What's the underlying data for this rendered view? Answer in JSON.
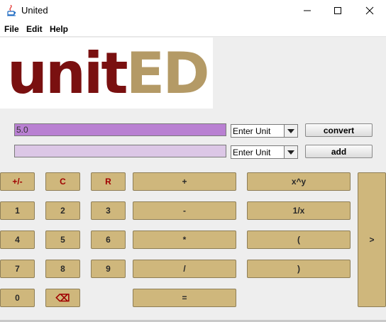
{
  "window": {
    "title": "United"
  },
  "menu": {
    "file": "File",
    "edit": "Edit",
    "help": "Help"
  },
  "logo": {
    "part1": "unit",
    "part2": "ED"
  },
  "converter": {
    "input_value": "5.0",
    "output_value": "",
    "unit1": "Enter Unit",
    "unit2": "Enter Unit",
    "convert_label": "convert",
    "add_label": "add",
    "input_color": "#b980d2",
    "output_color": "#dcc7e6"
  },
  "keys": {
    "negate": "+/-",
    "clear": "C",
    "reset": "R",
    "plus": "+",
    "power": "x^y",
    "one": "1",
    "two": "2",
    "three": "3",
    "minus": "-",
    "reciprocal": "1/x",
    "four": "4",
    "five": "5",
    "six": "6",
    "multiply": "*",
    "open_paren": "(",
    "seven": "7",
    "eight": "8",
    "nine": "9",
    "divide": "/",
    "close_paren": ")",
    "zero": "0",
    "backspace": "⌫",
    "equals": "=",
    "next": ">"
  },
  "colors": {
    "key_fill": "#cfb77c",
    "key_accent": "#a00000",
    "logo_red": "#7a1010",
    "logo_gold": "#b49a66"
  }
}
